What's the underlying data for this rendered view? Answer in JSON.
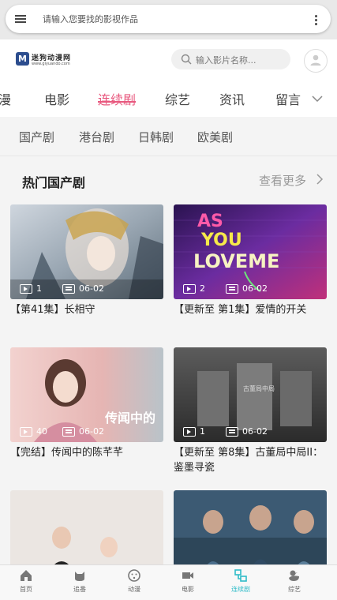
{
  "topbar": {
    "search_placeholder": "请输入您要找的影视作品"
  },
  "header": {
    "logo_mark": "M",
    "logo_name": "迷狗动漫网",
    "logo_sub": "www.giyuando.com",
    "search_placeholder": "输入影片名称..."
  },
  "categories": [
    "漫",
    "电影",
    "连续剧",
    "综艺",
    "资讯",
    "留言"
  ],
  "active_category": "连续剧",
  "subcategories": [
    "国产剧",
    "港台剧",
    "日韩剧",
    "欧美剧"
  ],
  "section": {
    "title": "热门国产剧",
    "more_label": "查看更多"
  },
  "cards": [
    {
      "title": "【第41集】长相守",
      "episodes": "1",
      "date": "06-02"
    },
    {
      "title": "【更新至 第1集】爱情的开关",
      "episodes": "2",
      "date": "06-02"
    },
    {
      "title": "【完结】传闻中的陈芊芊",
      "episodes": "40",
      "date": "06-02"
    },
    {
      "title": "【更新至 第8集】古董局中局II：鉴墨寻瓷",
      "episodes": "1",
      "date": "06-02"
    }
  ],
  "poster_texts": {
    "love_me": "AS YOU LOVE ME",
    "rumor": "传闻中的",
    "antique": "古董局中局"
  },
  "tabbar": [
    {
      "label": "首页",
      "icon": "home-icon"
    },
    {
      "label": "追番",
      "icon": "cat-icon"
    },
    {
      "label": "动漫",
      "icon": "smile-icon"
    },
    {
      "label": "电影",
      "icon": "camera-icon"
    },
    {
      "label": "连续剧",
      "icon": "tv-series-icon"
    },
    {
      "label": "综艺",
      "icon": "duck-icon"
    }
  ],
  "active_tab": "连续剧",
  "colors": {
    "accent_pink": "#e8587e",
    "accent_teal": "#2fbcc8"
  }
}
